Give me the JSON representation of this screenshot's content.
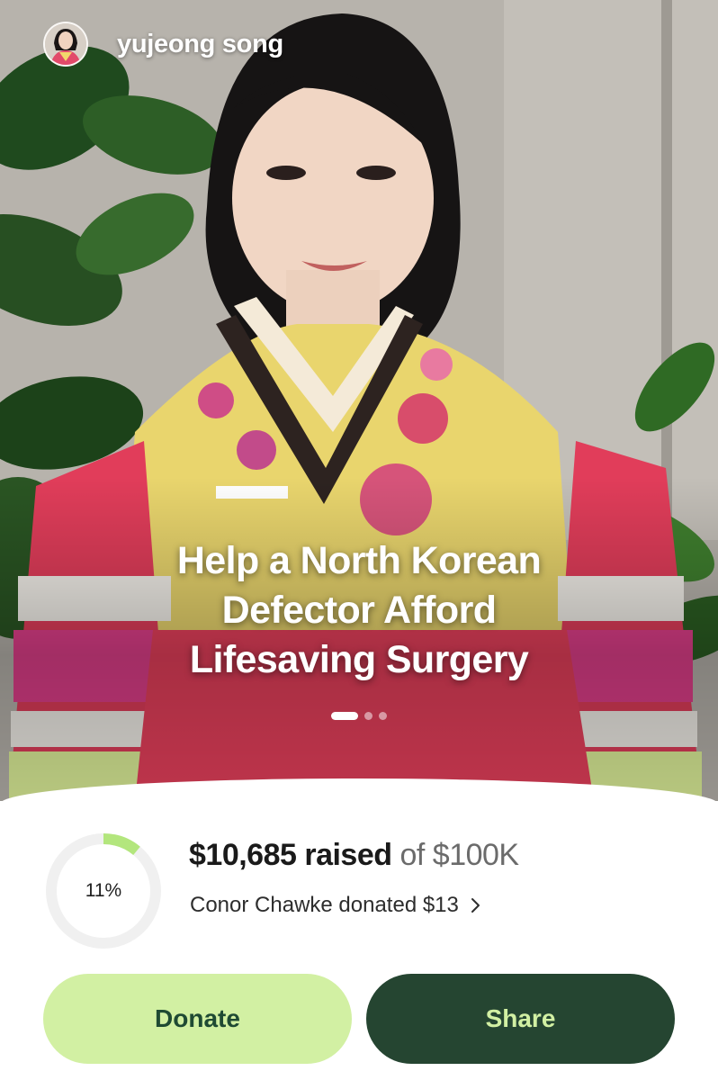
{
  "author": {
    "name": "yujeong song"
  },
  "campaign": {
    "title_lines": [
      "Help a North Korean",
      "Defector Afford",
      "Lifesaving Surgery"
    ],
    "slides": 3,
    "active_slide": 1
  },
  "progress": {
    "percent_label": "11%",
    "percent_value": 11,
    "raised_amount": "$10,685 raised",
    "goal_text": "of $100K",
    "recent_donation": "Conor Chawke donated $13"
  },
  "actions": {
    "donate_label": "Donate",
    "share_label": "Share"
  },
  "colors": {
    "accent_light": "#d2f0a3",
    "accent_dark": "#254531",
    "progress_fill": "#b3e67d",
    "progress_track": "#f0f0f0"
  }
}
